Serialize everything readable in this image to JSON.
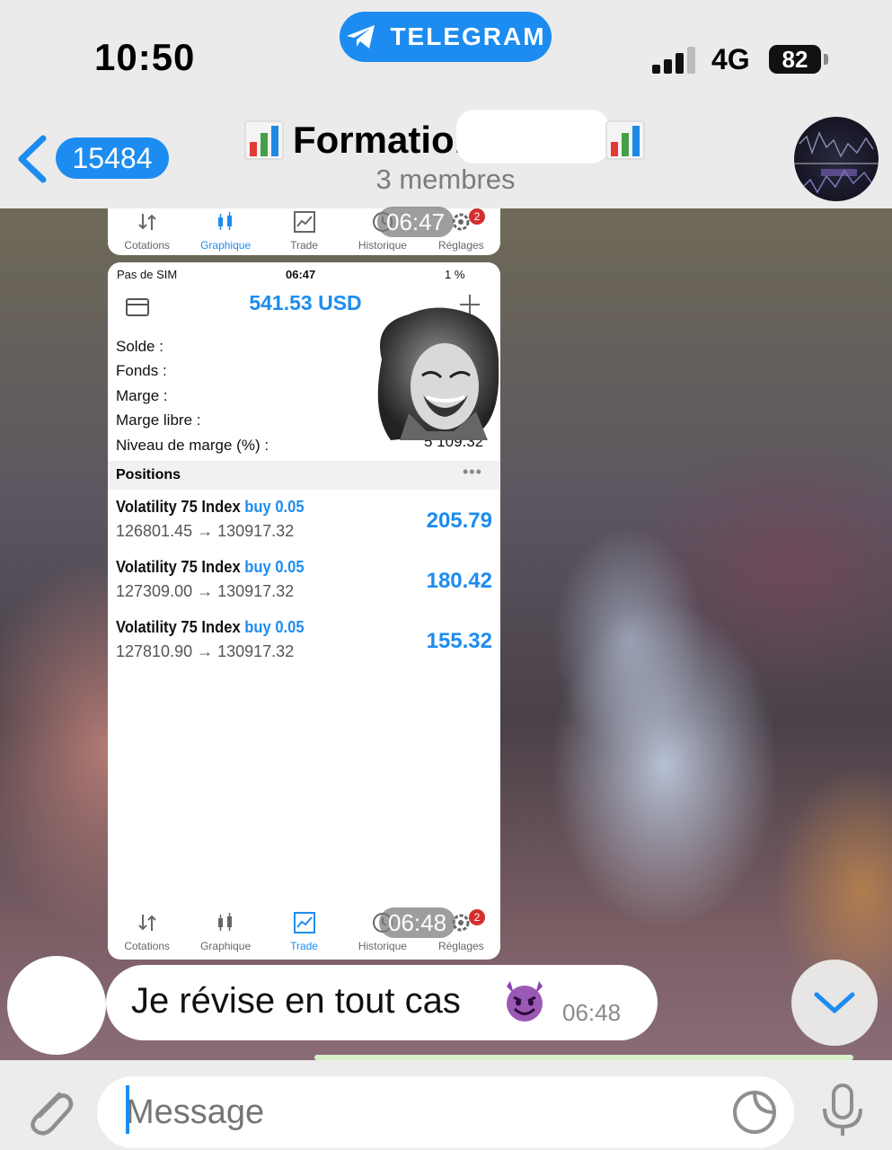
{
  "status_bar": {
    "time": "10:50",
    "app_pill": "TELEGRAM",
    "network": "4G",
    "battery": "82"
  },
  "header": {
    "back_count": "15484",
    "title": "Formation",
    "subtitle": "3 membres"
  },
  "phone": {
    "status": {
      "carrier": "Pas de SIM",
      "time": "06:47",
      "battery": "1 %"
    },
    "balance": "541.53 USD",
    "account_labels": [
      "Solde :",
      "Fonds :",
      "Marge :",
      "Marge libre :",
      "Niveau de marge (%) :"
    ],
    "partial_value": "5 109.32",
    "positions_title": "Positions",
    "positions_more": "•••",
    "positions": [
      {
        "symbol": "Volatility 75 Index",
        "side": "buy 0.05",
        "prices": "126801.45 → 130917.32",
        "profit": "205.79"
      },
      {
        "symbol": "Volatility 75 Index",
        "side": "buy 0.05",
        "prices": "127309.00 → 130917.32",
        "profit": "180.42"
      },
      {
        "symbol": "Volatility 75 Index",
        "side": "buy 0.05",
        "prices": "127810.90 → 130917.32",
        "profit": "155.32"
      }
    ],
    "tabs": [
      "Cotations",
      "Graphique",
      "Trade",
      "Historique",
      "Réglages"
    ],
    "badge": "2",
    "time_top": "06:47",
    "time_bottom": "06:48"
  },
  "message": {
    "text": "Je révise en tout cas",
    "time": "06:48",
    "emoji": "smiling-devil"
  },
  "input": {
    "placeholder": "Message"
  },
  "colors": {
    "accent": "#1d8cf0",
    "header_bg": "#ebebeb",
    "bubble_bg": "#ffffff",
    "badge_red": "#d32f2f"
  }
}
